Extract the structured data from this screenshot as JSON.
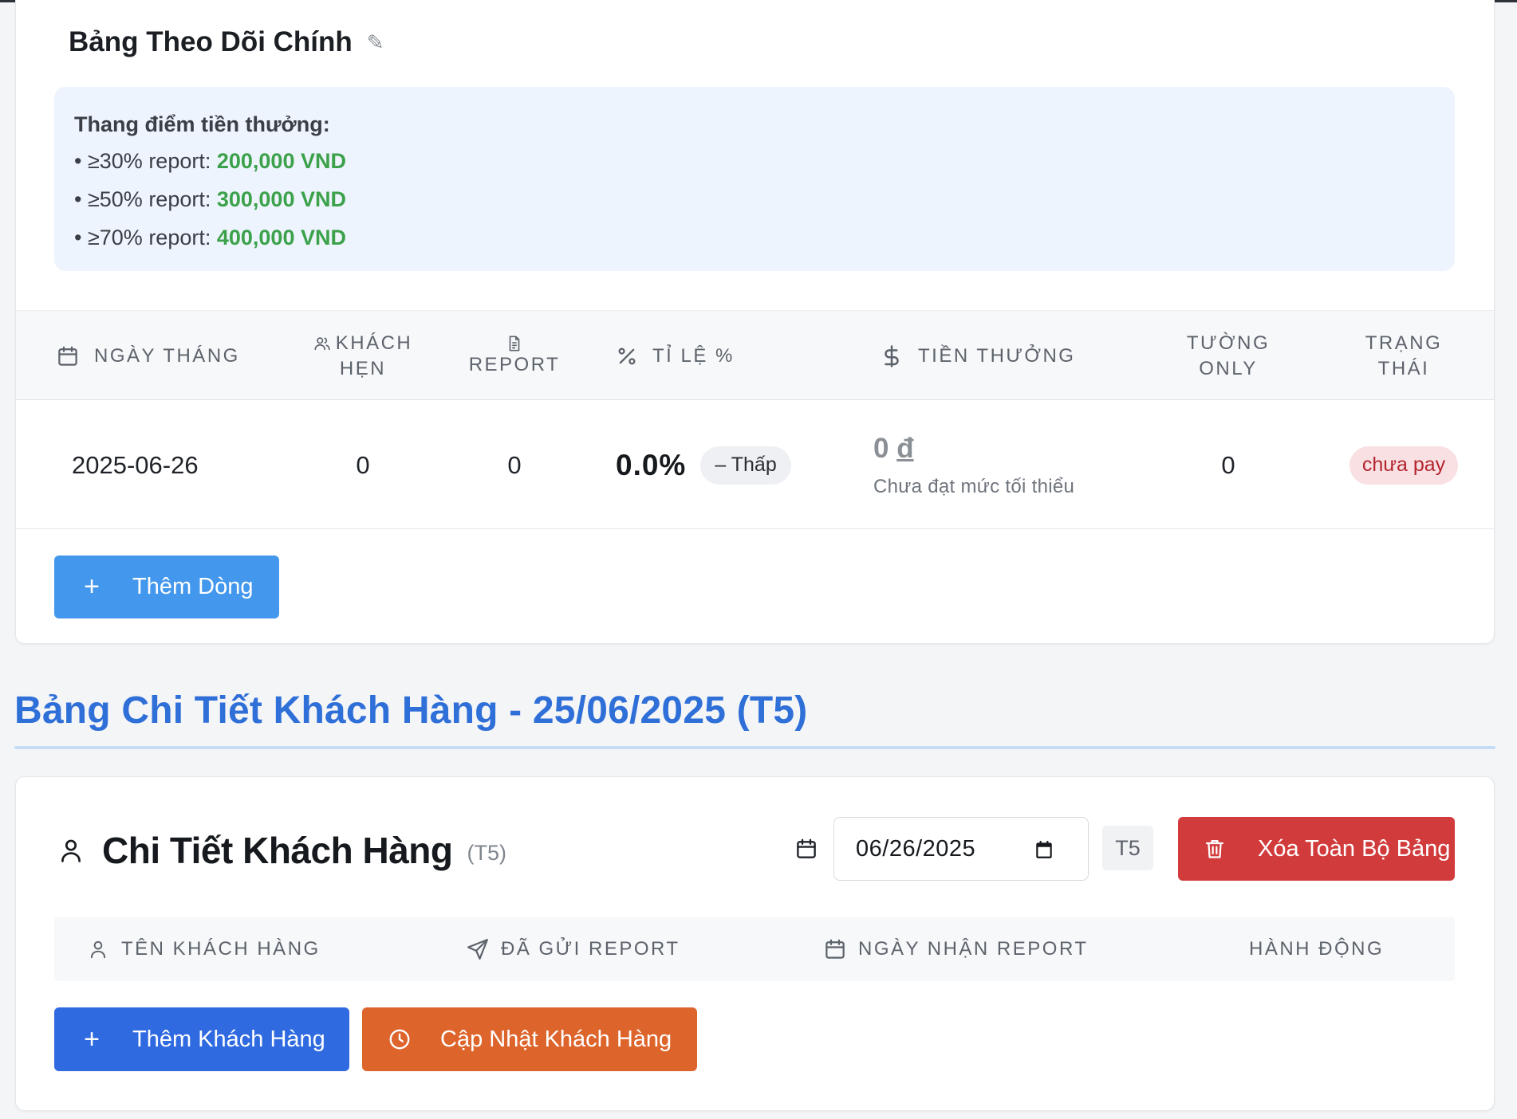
{
  "tracking": {
    "title": "Bảng Theo Dõi Chính",
    "edit_icon": "✎",
    "scale": {
      "heading": "Thang điểm tiền thưởng:",
      "tiers": [
        {
          "label": "• ≥30% report: ",
          "value": "200,000 VND"
        },
        {
          "label": "• ≥50% report: ",
          "value": "300,000 VND"
        },
        {
          "label": "• ≥70% report: ",
          "value": "400,000 VND"
        }
      ]
    },
    "columns": {
      "date": "NGÀY THÁNG",
      "appt_1": "KHÁCH",
      "appt_2": "HẸN",
      "report": "REPORT",
      "rate": "TỈ LỆ %",
      "bonus": "TIỀN THƯỞNG",
      "tuong_1": "TƯỜNG",
      "tuong_2": "ONLY",
      "status_1": "TRẠNG",
      "status_2": "THÁI"
    },
    "row": {
      "date": "2025-06-26",
      "appointments": "0",
      "reports": "0",
      "rate": "0.0%",
      "rate_level": "– Thấp",
      "bonus_amount": "0",
      "bonus_currency": "đ",
      "bonus_note": "Chưa đạt mức tối thiểu",
      "tuong_only": "0",
      "status": "chưa pay"
    },
    "add_row_label": "Thêm Dòng"
  },
  "section_title": "Bảng Chi Tiết Khách Hàng - 25/06/2025 (T5)",
  "details": {
    "title": "Chi Tiết Khách Hàng",
    "day_tag": "(T5)",
    "date_value": "06/26/2025",
    "weekday": "T5",
    "clear_label": "Xóa Toàn Bộ Bảng",
    "columns": {
      "name": "TÊN KHÁCH HÀNG",
      "sent": "ĐÃ GỬI REPORT",
      "received": "NGÀY NHẬN REPORT",
      "actions": "HÀNH ĐỘNG"
    },
    "add_customer_label": "Thêm Khách Hàng",
    "update_customer_label": "Cập Nhật Khách Hàng"
  },
  "colors": {
    "accent_blue": "#2f6fd8",
    "tier_green": "#3ba14a",
    "danger_red": "#d23b3b",
    "update_orange": "#dd652c",
    "add_row_blue": "#4397ec",
    "status_text": "#b4252f"
  }
}
